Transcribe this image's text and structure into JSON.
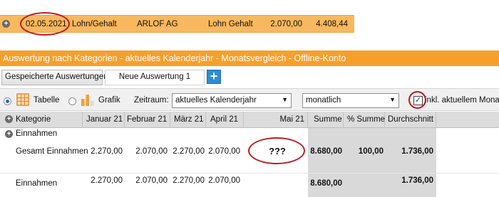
{
  "transaction": {
    "date": "02.05.2021",
    "type": "Lohn/Gehalt",
    "payee": "ARLOF AG",
    "category": "Lohn Gehalt",
    "amount": "2.070,00",
    "balance": "4.408,44"
  },
  "report_title": "Auswertung nach Kategorien - aktuelles Kalenderjahr - Monatsvergleich - Offline-Konto",
  "tabs": {
    "saved": "Gespeicherte Auswertungen",
    "new": "Neue Auswertung 1",
    "add": "+"
  },
  "toolbar": {
    "table_label": "Tabelle",
    "chart_label": "Grafik",
    "period_label": "Zeitraum:",
    "period_value": "aktuelles Kalenderjahr",
    "interval_value": "monatlich",
    "include_current_label": "inkl. aktuellem Monat",
    "checkmark": "✓"
  },
  "grid": {
    "columns": [
      "Kategorie",
      "Januar 21",
      "Februar 21",
      "März 21",
      "April 21",
      "Mai 21",
      "Summe",
      "% Summe",
      "Durchschnitt"
    ],
    "rows": [
      {
        "label": "Einnahmen",
        "values": [
          "",
          "",
          "",
          "",
          "",
          "",
          "",
          ""
        ]
      },
      {
        "label": "Gesamt Einnahmen",
        "values": [
          "2.270,00",
          "2.070,00",
          "2.270,00",
          "2.070,00",
          "???",
          "8.680,00",
          "100,00",
          "1.736,00"
        ]
      },
      {
        "label": "Einnahmen",
        "values": [
          "2.270,00",
          "2.070,00",
          "2.270,00",
          "2.070,00",
          "",
          "8.680,00",
          "",
          "1.736,00"
        ]
      }
    ]
  },
  "colors": {
    "accent_orange": "#f5a02c",
    "row_highlight": "#f8b85f",
    "annotation_red": "#b81d1d"
  }
}
